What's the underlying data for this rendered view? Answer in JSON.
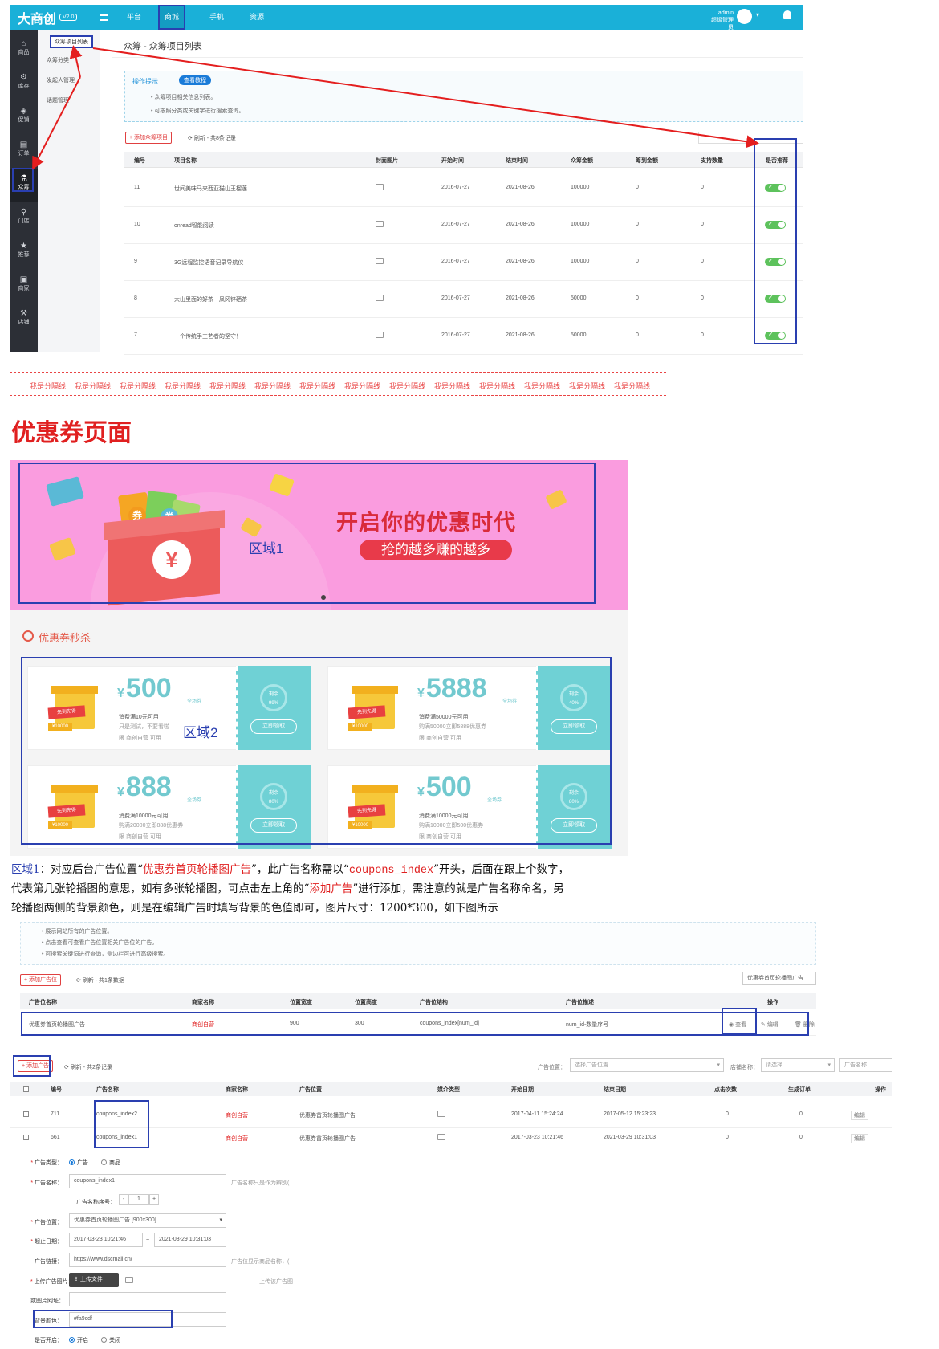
{
  "admin": {
    "logo": "大商创",
    "version": "V2.0",
    "nav": [
      "平台",
      "商城",
      "手机",
      "资源"
    ],
    "user": "admin",
    "role": "超级管理员",
    "sidebar": [
      "商品",
      "库存",
      "促销",
      "订单",
      "众筹",
      "门店",
      "推荐",
      "商家",
      "店铺"
    ],
    "subnav": [
      "众筹项目列表",
      "众筹分类",
      "发起人管理",
      "话题管理"
    ],
    "page_title": "众筹 - 众筹项目列表",
    "tip_title": "操作提示",
    "tip_button": "查看教程",
    "tips": [
      "众筹项目相关信息列表。",
      "可按照分类或关键字进行搜索查询。"
    ],
    "add_button": "添加众筹项目",
    "refresh": "刷新 - 共8条记录",
    "columns": [
      "编号",
      "项目名称",
      "封面图片",
      "开始时间",
      "结束时间",
      "众筹金额",
      "筹到金额",
      "支持数量",
      "是否推荐"
    ],
    "rows": [
      {
        "id": "11",
        "name": "世间美味马来西亚猫山王榴莲",
        "start": "2016-07-27",
        "end": "2021-08-26",
        "amount": "100000",
        "raised": "0",
        "support": "0"
      },
      {
        "id": "10",
        "name": "onread智能阅读",
        "start": "2016-07-27",
        "end": "2021-08-26",
        "amount": "100000",
        "raised": "0",
        "support": "0"
      },
      {
        "id": "9",
        "name": "3G远程监控语音记录导航仪",
        "start": "2016-07-27",
        "end": "2021-08-26",
        "amount": "100000",
        "raised": "0",
        "support": "0"
      },
      {
        "id": "8",
        "name": "大山里面的好茶—凤冈锌硒茶",
        "start": "2016-07-27",
        "end": "2021-08-26",
        "amount": "50000",
        "raised": "0",
        "support": "0"
      },
      {
        "id": "7",
        "name": "一个传统手工艺者的坚守！",
        "start": "2016-07-27",
        "end": "2021-08-26",
        "amount": "50000",
        "raised": "0",
        "support": "0"
      }
    ]
  },
  "separator": "我是分隔线",
  "section_title": "优惠券页面",
  "banner": {
    "headline": "开启你的优惠时代",
    "subline": "抢的越多赚的越多",
    "region_label": "区域1",
    "coupon_word": "券",
    "yen": "¥"
  },
  "seckill": {
    "title": "优惠券秒杀",
    "region_label": "区域2",
    "gift_label": "先到先得",
    "gift_price": "¥10000",
    "yen": "¥",
    "tag": "全场券",
    "remain_label": "剩余",
    "button": "立即领取",
    "cards": [
      {
        "value": "500",
        "line1": "消费满10元可用",
        "line2": "只是测试，不要看啦",
        "line3": "限 商创自营 可用",
        "remain": "99%"
      },
      {
        "value": "5888",
        "line1": "消费满50000元可用",
        "line2": "购满50000立即5888优惠券",
        "line3": "限 商创自营 可用",
        "remain": "40%"
      },
      {
        "value": "888",
        "line1": "消费满10000元可用",
        "line2": "购满20000立即888优惠券",
        "line3": "限 商创自营 可用",
        "remain": "80%"
      },
      {
        "value": "500",
        "line1": "消费满10000元可用",
        "line2": "购满10000立即500优惠券",
        "line3": "限 商创自营 可用",
        "remain": "80%"
      }
    ]
  },
  "description": {
    "l1a": "区域1",
    "l1b": "：对应后台广告位置“",
    "l1c": "优惠券首页轮播图广告",
    "l1d": "”，此广告名称需以“",
    "l1e": "coupons_index",
    "l1f": "”开头，后面在跟上个数字，",
    "l2a": "代表第几张轮播图的意思，如有多张轮播图，可点击左上角的“",
    "l2b": "添加广告",
    "l2c": "”进行添加，需注意的就是广告名称命名，另",
    "l3": "轮播图两侧的背景颜色，则是在编辑广告时填写背景的色值即可，图片尺寸：1200*300，如下图所示"
  },
  "adpos": {
    "tips": [
      "展示网站所有的广告位置。",
      "点击查看可查看广告位置相关广告位的广告。",
      "可搜索关键词进行查询，侧边栏可进行高级搜索。"
    ],
    "add_button": "添加广告位",
    "refresh": "刷新 - 共1条数据",
    "search_value": "优惠券首页轮播图广告",
    "columns": [
      "广告位名称",
      "商家名称",
      "位置宽度",
      "位置高度",
      "广告位结构",
      "广告位描述",
      "操作"
    ],
    "row": {
      "name": "优惠券首页轮播图广告",
      "merchant": "商创自营",
      "width": "900",
      "height": "300",
      "structure": "coupons_index[num_id]",
      "desc": "num_id-数量序号"
    },
    "actions": [
      "查看",
      "编辑",
      "删除"
    ]
  },
  "adlist": {
    "add_button": "添加广告",
    "refresh": "刷新 - 共2条记录",
    "filter_pos_label": "广告位置：",
    "filter_pos_placeholder": "选择广告位置",
    "filter_shop_label": "店铺名称：",
    "filter_shop_placeholder": "请选择...",
    "filter_name_placeholder": "广告名称",
    "columns": [
      "编号",
      "广告名称",
      "商家名称",
      "广告位置",
      "媒介类型",
      "开始日期",
      "结束日期",
      "点击次数",
      "生成订单",
      "操作"
    ],
    "rows": [
      {
        "id": "711",
        "name": "coupons_index2",
        "merchant": "商创自营",
        "pos": "优惠券首页轮播图广告",
        "start": "2017-04-11 15:24:24",
        "end": "2017-05-12 15:23:23",
        "clicks": "0",
        "orders": "0"
      },
      {
        "id": "661",
        "name": "coupons_index1",
        "merchant": "商创自营",
        "pos": "优惠券首页轮播图广告",
        "start": "2017-03-23 10:21:46",
        "end": "2021-03-29 10:31:03",
        "clicks": "0",
        "orders": "0"
      }
    ],
    "edit": "编辑"
  },
  "form": {
    "type_label": "广告类型：",
    "type_opt1": "广告",
    "type_opt2": "商品",
    "name_label": "广告名称：",
    "name_value": "coupons_index1",
    "name_hint": "广告名称只是作为辨别(",
    "seq_label": "广告名称序号：",
    "seq_minus": "-",
    "seq_value": "1",
    "seq_plus": "+",
    "pos_label": "广告位置：",
    "pos_value": "优惠券首页轮播图广告 [900x300]",
    "date_label": "起止日期：",
    "date_start": "2017-03-23 10:21:46",
    "date_sep": "~",
    "date_end": "2021-03-29 10:31:03",
    "link_label": "广告链接：",
    "link_value": "https://www.dscmall.cn/",
    "link_hint": "广告位显示商品名称，(",
    "upload_label": "上传广告图片：",
    "upload_button": "上传文件",
    "upload_hint": "上传该广告图",
    "img_url_label": "或图片网址：",
    "bg_label": "背景颜色：",
    "bg_value": "#fa9cdf",
    "enabled_label": "是否开启：",
    "enabled_on": "开启",
    "enabled_off": "关闭"
  }
}
